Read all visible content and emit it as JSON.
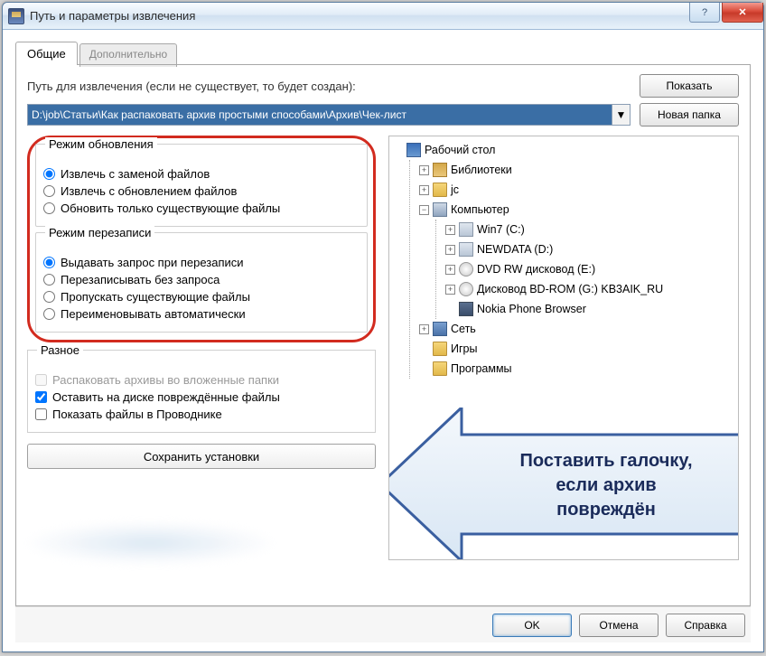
{
  "title": "Путь и параметры извлечения",
  "tabs": {
    "general": "Общие",
    "advanced": "Дополнительно"
  },
  "path_label": "Путь для извлечения (если не существует, то будет создан):",
  "path_value": "D:\\job\\Статьи\\Как распаковать архив простыми способами\\Архив\\Чек-лист",
  "btn_show": "Показать",
  "btn_newfolder": "Новая папка",
  "update_mode": {
    "legend": "Режим обновления",
    "o1": "Извлечь с заменой файлов",
    "o2": "Извлечь с обновлением файлов",
    "o3": "Обновить только существующие файлы"
  },
  "overwrite_mode": {
    "legend": "Режим перезаписи",
    "o1": "Выдавать запрос при перезаписи",
    "o2": "Перезаписывать без запроса",
    "o3": "Пропускать существующие файлы",
    "o4": "Переименовывать автоматически"
  },
  "misc": {
    "legend": "Разное",
    "c1": "Распаковать архивы во вложенные папки",
    "c2": "Оставить на диске повреждённые файлы",
    "c3": "Показать файлы в Проводнике"
  },
  "save_settings": "Сохранить установки",
  "tree": {
    "desktop": "Рабочий стол",
    "lib": "Библиотеки",
    "jc": "jc",
    "computer": "Компьютер",
    "drives": {
      "c": "Win7 (C:)",
      "d": "NEWDATA (D:)",
      "e": "DVD RW дисковод (E:)",
      "g": "Дисковод BD-ROM (G:) KB3AIK_RU",
      "nokia": "Nokia Phone Browser"
    },
    "net": "Сеть",
    "games": "Игры",
    "prog": "Программы"
  },
  "callout": {
    "line1": "Поставить галочку,",
    "line2": "если архив",
    "line3": "повреждён"
  },
  "footer": {
    "ok": "OK",
    "cancel": "Отмена",
    "help": "Справка"
  }
}
